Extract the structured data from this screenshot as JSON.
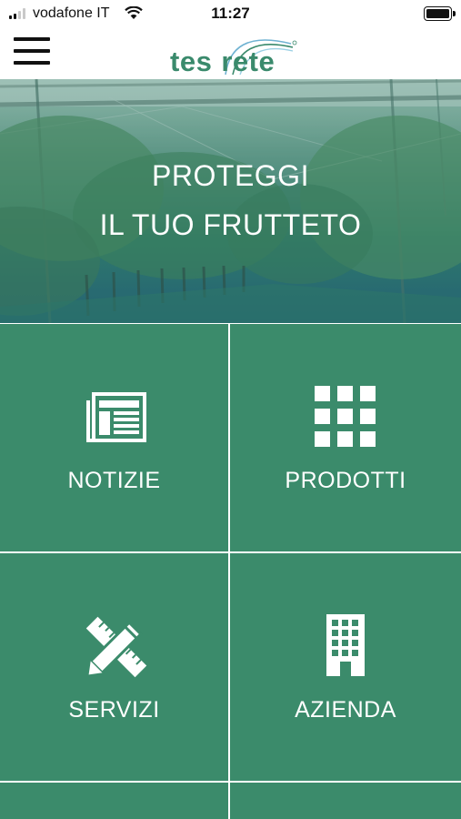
{
  "status_bar": {
    "carrier": "vodafone IT",
    "time": "11:27"
  },
  "header": {
    "logo_part1": "tes",
    "logo_part2": "rete",
    "menu_icon": "hamburger-menu-icon"
  },
  "hero": {
    "line1": "PROTEGGI",
    "line2": "IL TUO FRUTTETO"
  },
  "tiles": [
    {
      "label": "NOTIZIE",
      "icon": "newspaper-icon"
    },
    {
      "label": "PRODOTTI",
      "icon": "grid-icon"
    },
    {
      "label": "SERVIZI",
      "icon": "pencil-ruler-icon"
    },
    {
      "label": "AZIENDA",
      "icon": "building-icon"
    }
  ],
  "colors": {
    "tile_green": "#3b8b6b",
    "logo_green": "#3a8a6c",
    "hero_teal": "#2f7d6a"
  }
}
